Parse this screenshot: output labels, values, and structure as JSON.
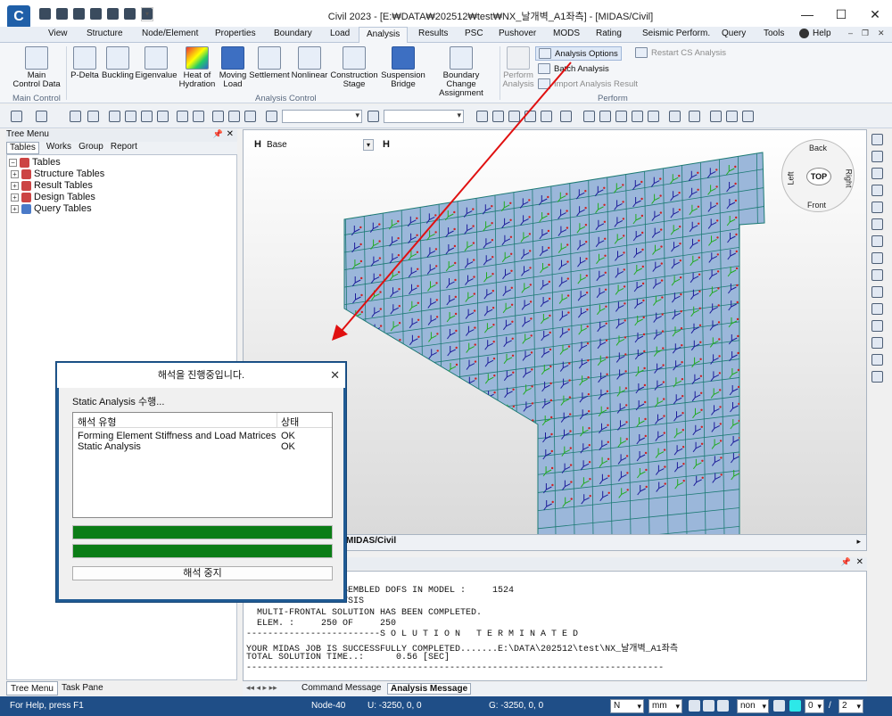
{
  "titlebar": {
    "logo": "C",
    "title": "Civil 2023 - [E:₩DATA₩202512₩test₩NX_날개벽_A1좌측] - [MIDAS/Civil]",
    "minimize": "—",
    "maximize": "☐",
    "close": "✕"
  },
  "tabs": [
    "View",
    "Structure",
    "Node/Element",
    "Properties",
    "Boundary",
    "Load",
    "Analysis",
    "Results",
    "PSC",
    "Pushover",
    "MODS",
    "Rating",
    "Seismic Perform.",
    "Query",
    "Tools"
  ],
  "active_tab": "Analysis",
  "help_label": "Help",
  "ribbon": {
    "main_control": {
      "label_line1": "Main",
      "label_line2": "Control Data",
      "group": "Main Control"
    },
    "analysis_control": {
      "group": "Analysis Control",
      "buttons": [
        {
          "line1": "P-Delta",
          "line2": ""
        },
        {
          "line1": "Buckling",
          "line2": ""
        },
        {
          "line1": "Eigenvalue",
          "line2": ""
        },
        {
          "line1": "Heat of",
          "line2": "Hydration"
        },
        {
          "line1": "Moving",
          "line2": "Load"
        },
        {
          "line1": "Settlement",
          "line2": ""
        },
        {
          "line1": "Nonlinear",
          "line2": ""
        },
        {
          "line1": "Construction",
          "line2": "Stage"
        },
        {
          "line1": "Suspension",
          "line2": "Bridge"
        },
        {
          "line1": "Boundary Change",
          "line2": "Assignment"
        }
      ]
    },
    "perform": {
      "group": "Perform",
      "perform_analysis_line1": "Perform",
      "perform_analysis_line2": "Analysis",
      "analysis_options": "Analysis Options",
      "batch_analysis": "Batch Analysis",
      "import_analysis_result": "Import Analysis Result",
      "restart_cs_analysis": "Restart CS Analysis"
    }
  },
  "tree_menu": {
    "title": "Tree Menu",
    "tabs": [
      "Tables",
      "Works",
      "Group",
      "Report"
    ],
    "root": "Tables",
    "items": [
      "Structure Tables",
      "Result Tables",
      "Design Tables",
      "Query Tables"
    ],
    "bottom_tabs": [
      "Tree Menu",
      "Task Pane"
    ]
  },
  "viewport": {
    "base_label": "Base",
    "tab_label": "MIDAS/Civil",
    "viewcube": {
      "back": "Back",
      "left": "Left",
      "right": "Right",
      "front": "Front",
      "top": "TOP"
    }
  },
  "messages": {
    "lines": [
      "TOTAL NUMBER OF ASSEMBLED DOFS IN MODEL :     1524",
      "LINEAR STATIC ANALYSIS",
      "  MULTI-FRONTAL SOLUTION HAS BEEN COMPLETED.",
      "  ELEM. :     250 OF     250",
      "-------------------------S O L U T I O N   T E R M I N A T E D",
      "YOUR MIDAS JOB IS SUCCESSFULLY COMPLETED.......E:\\DATA\\202512\\test\\NX_날개벽_A1좌측",
      "TOTAL SOLUTION TIME..:      0.56 [SEC]",
      "------------------------------------------------------------------------------"
    ],
    "tabs": [
      "Command Message",
      "Analysis Message"
    ],
    "active_tab": "Analysis Message"
  },
  "statusbar": {
    "help": "For Help, press F1",
    "node": "Node-40",
    "u_coord": "U: -3250, 0, 0",
    "g_coord": "G: -3250, 0, 0",
    "unit_force": "N",
    "unit_length": "mm",
    "filter": "non",
    "page_current": "0",
    "page_sep": "/",
    "page_total": "2"
  },
  "dialog": {
    "title": "해석을 진행중입니다.",
    "status": "Static Analysis 수행...",
    "col_type": "해석 유형",
    "col_status": "상태",
    "rows": [
      {
        "type": "Forming Element Stiffness and Load Matrices",
        "status": "OK"
      },
      {
        "type": "Static Analysis",
        "status": "OK"
      }
    ],
    "progress1": 1.0,
    "progress2": 1.0,
    "stop_button": "해석 중지"
  },
  "colors": {
    "accent": "#1f5a93",
    "progress": "#0b7d16",
    "mesh_fill": "#9bb7da",
    "mesh_line": "#1c7a74",
    "arrow": "#e01010"
  }
}
